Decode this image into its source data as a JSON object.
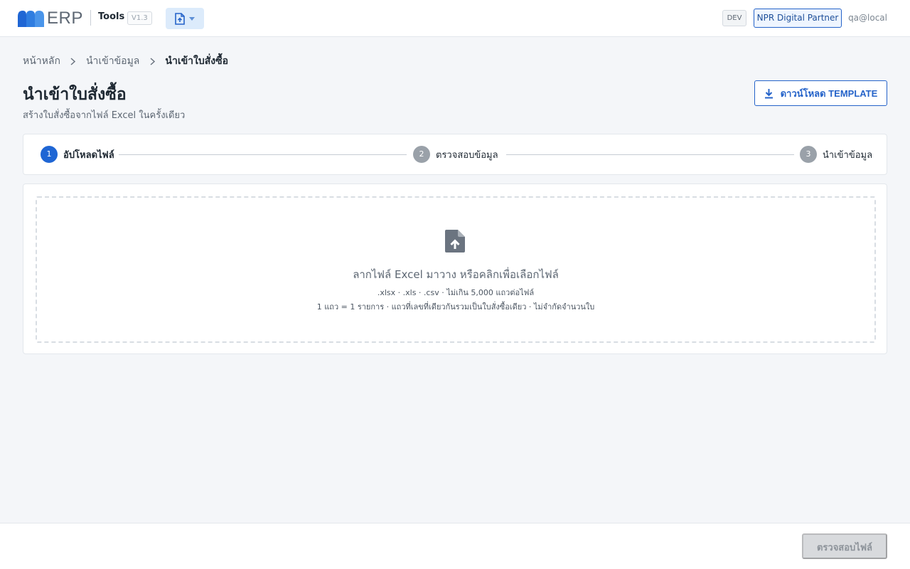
{
  "header": {
    "logo_text": "ERP",
    "app_name": "Tools",
    "version": "V1.3",
    "env_badge": "DEV",
    "partner_button": "NPR Digital Partner",
    "user": "qa@local"
  },
  "breadcrumb": {
    "items": [
      "หน้าหลัก",
      "นำเข้าข้อมูล",
      "นำเข้าใบสั่งซื้อ"
    ]
  },
  "page": {
    "title": "นำเข้าใบสั่งซื้อ",
    "subtitle": "สร้างใบสั่งซื้อจากไฟล์ Excel ในครั้งเดียว",
    "download_button": "ดาวน์โหลด TEMPLATE"
  },
  "stepper": {
    "steps": [
      {
        "number": "1",
        "label": "อัปโหลดไฟล์",
        "state": "active"
      },
      {
        "number": "2",
        "label": "ตรวจสอบข้อมูล",
        "state": "inactive"
      },
      {
        "number": "3",
        "label": "นำเข้าข้อมูล",
        "state": "inactive"
      }
    ]
  },
  "upload": {
    "title": "ลากไฟล์ Excel มาวาง หรือคลิกเพื่อเลือกไฟล์",
    "hint_formats": ".xlsx · .xls · .csv · ไม่เกิน 5,000 แถวต่อไฟล์",
    "hint_rules": "1 แถว = 1 รายการ · แถวที่เลขที่เดียวกันรวมเป็นใบสั่งซื้อเดียว · ไม่จำกัดจำนวนใบ"
  },
  "footer": {
    "check_button": "ตรวจสอบไฟล์"
  },
  "icons": {
    "module": "file-upload-icon",
    "dropdown": "caret-down-icon",
    "breadcrumb_separator": "chevron-right-icon",
    "download": "download-icon",
    "dropzone": "file-upload-icon"
  },
  "colors": {
    "primary": "#1f66d4",
    "partner_border": "#2563c9",
    "background": "#f4f6f9",
    "disabled_button": "#d8dadd"
  }
}
